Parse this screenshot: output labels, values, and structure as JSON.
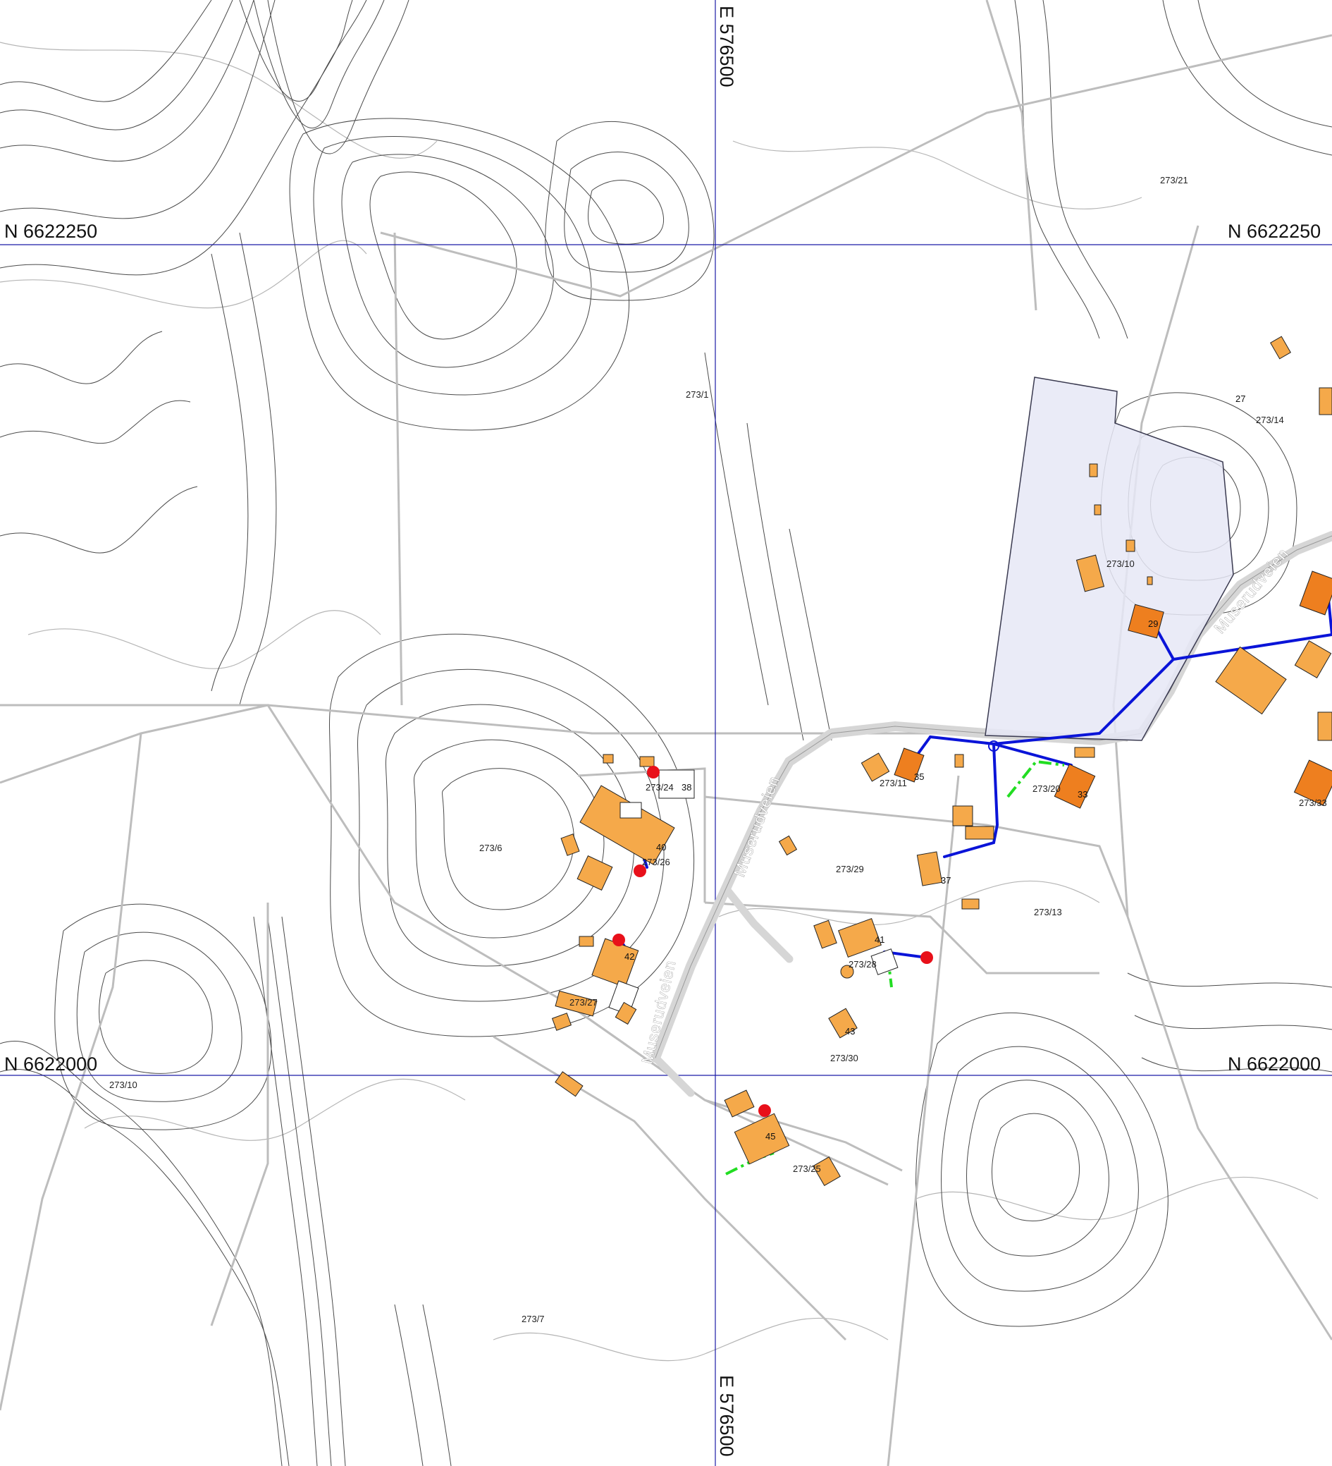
{
  "map": {
    "grid_labels": {
      "easting_top": "E 576500",
      "easting_bottom": "E 576500",
      "northing_top_left": "N 6622250",
      "northing_top_right": "N 6622250",
      "northing_bottom_left": "N 6622000",
      "northing_bottom_right": "N 6622000"
    },
    "road_labels": [
      "Muserudveien",
      "Muserudveien",
      "Muserudveien"
    ],
    "parcel_labels": [
      "273/21",
      "273/1",
      "273/14",
      "273/10",
      "273/6",
      "273/24",
      "273/26",
      "273/11",
      "273/20",
      "273/29",
      "273/13",
      "273/28",
      "273/27",
      "273/30",
      "273/10",
      "273/25",
      "273/7",
      "273/33"
    ],
    "house_numbers": [
      "27",
      "29",
      "38",
      "40",
      "35",
      "33",
      "37",
      "41",
      "42",
      "43",
      "45"
    ],
    "colors": {
      "contour": "#4a4a4a",
      "contour_light": "#b5b5b5",
      "boundary": "#bdbdbd",
      "grid": "#1a1aa6",
      "building": "#f5a94a",
      "building_dark": "#ee7f1f",
      "pipe": "#0a14d8",
      "drain": "#22dd22",
      "manhole": "#e8101a",
      "zone_fill": "#e6e8f6",
      "zone_edge": "#3a3a50",
      "road": "#d6d6d6"
    }
  }
}
